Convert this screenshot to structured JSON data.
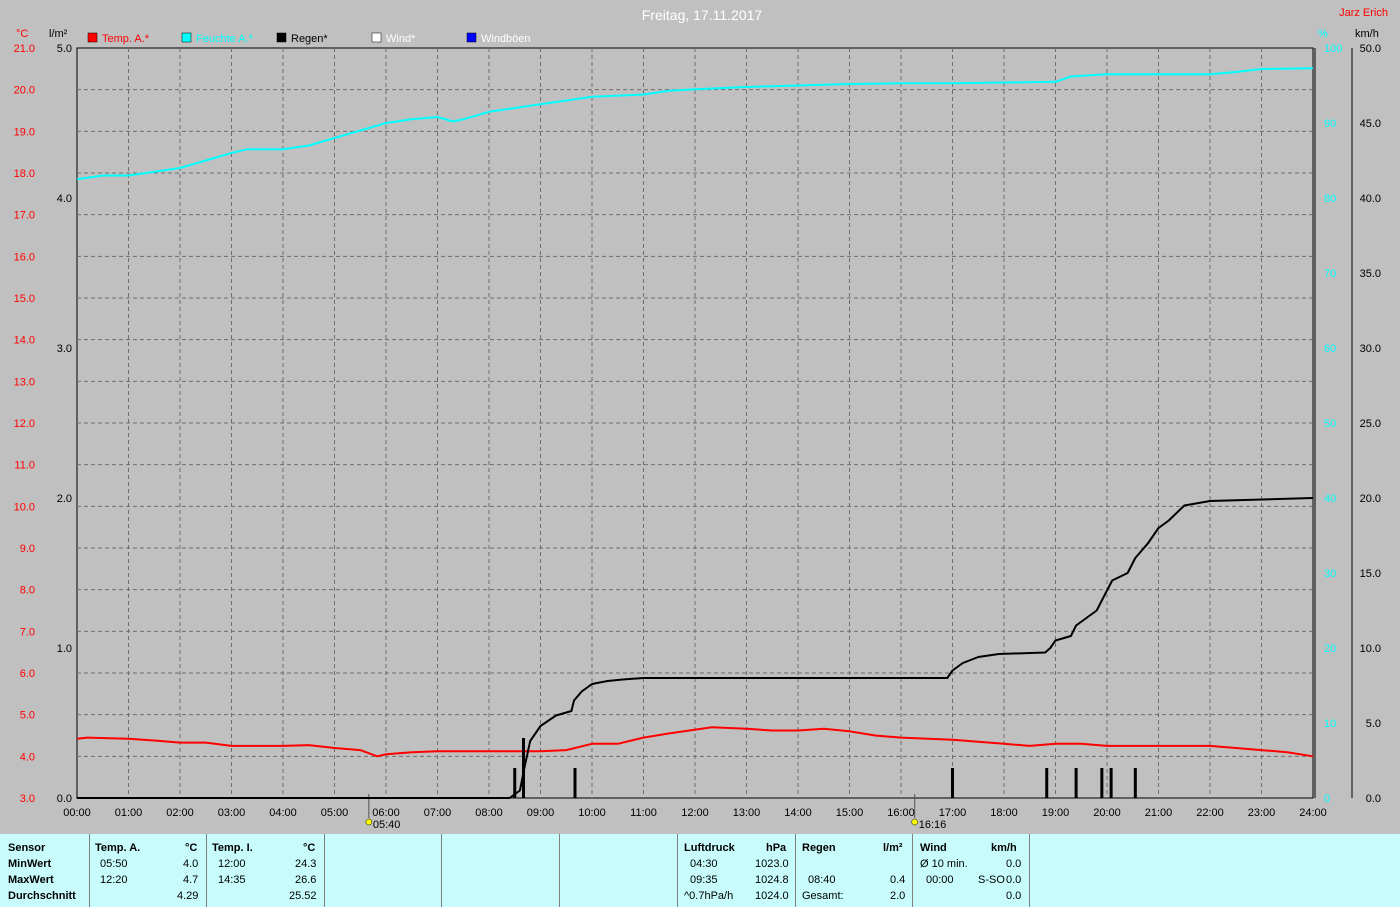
{
  "header": {
    "title": "Freitag, 17.11.2017",
    "station": "Jarz Erich",
    "unit_temp": "°C",
    "unit_rain": "l/m²",
    "unit_pressure": "%",
    "unit_wind": "km/h"
  },
  "colors": {
    "background": "#c0c0c0",
    "temp": "#ff0000",
    "pressure": "#00ffff",
    "rain": "#000000",
    "table_bg": "#c8fcfc"
  },
  "legend": [
    {
      "label": "Temp. A.*",
      "color": "#ff0000"
    },
    {
      "label": "Feuchte A.*",
      "color": "#00ffff"
    },
    {
      "label": "Regen*",
      "color": "#000000"
    },
    {
      "label": "Wind*",
      "color": "#ffffff"
    },
    {
      "label": "Windböen",
      "color": "#0000ff"
    }
  ],
  "axes": {
    "temp_ticks": [
      "21.0",
      "20.0",
      "19.0",
      "18.0",
      "17.0",
      "16.0",
      "15.0",
      "14.0",
      "13.0",
      "12.0",
      "11.0",
      "10.0",
      "9.0",
      "8.0",
      "7.0",
      "6.0",
      "5.0",
      "4.0",
      "3.0"
    ],
    "rain_ticks": [
      "5.0",
      "4.0",
      "3.0",
      "2.0",
      "1.0",
      "0.0"
    ],
    "humidity_ticks": [
      "100",
      "90",
      "80",
      "70",
      "60",
      "50",
      "40",
      "30",
      "20",
      "10",
      "0"
    ],
    "wind_ticks": [
      "50.0",
      "45.0",
      "40.0",
      "35.0",
      "30.0",
      "25.0",
      "20.0",
      "15.0",
      "10.0",
      "5.0",
      "0.0"
    ],
    "time_ticks": [
      "00:00",
      "01:00",
      "02:00",
      "03:00",
      "04:00",
      "05:00",
      "06:00",
      "07:00",
      "08:00",
      "09:00",
      "10:00",
      "11:00",
      "12:00",
      "13:00",
      "14:00",
      "15:00",
      "16:00",
      "17:00",
      "18:00",
      "19:00",
      "20:00",
      "21:00",
      "22:00",
      "23:00",
      "24:00"
    ],
    "sunrise": "05:40",
    "sunset": "16:16"
  },
  "chart_data": {
    "type": "line",
    "title": "Freitag, 17.11.2017",
    "x_unit": "hours",
    "temp_range": [
      3,
      21
    ],
    "rain_range": [
      0,
      5
    ],
    "humidity_range": [
      0,
      100
    ],
    "series": [
      {
        "name": "Temp. A.*",
        "axis": "temp",
        "points": [
          [
            0,
            4.42
          ],
          [
            0.2,
            4.45
          ],
          [
            1,
            4.42
          ],
          [
            1.5,
            4.38
          ],
          [
            2,
            4.33
          ],
          [
            2.5,
            4.33
          ],
          [
            3,
            4.25
          ],
          [
            4,
            4.25
          ],
          [
            4.5,
            4.27
          ],
          [
            5,
            4.2
          ],
          [
            5.5,
            4.15
          ],
          [
            5.83,
            4.0
          ],
          [
            6,
            4.05
          ],
          [
            6.5,
            4.1
          ],
          [
            7,
            4.12
          ],
          [
            8,
            4.12
          ],
          [
            9,
            4.12
          ],
          [
            9.5,
            4.15
          ],
          [
            10,
            4.3
          ],
          [
            10.5,
            4.3
          ],
          [
            11,
            4.45
          ],
          [
            11.5,
            4.55
          ],
          [
            12.33,
            4.7
          ],
          [
            13,
            4.66
          ],
          [
            13.5,
            4.62
          ],
          [
            14,
            4.62
          ],
          [
            14.5,
            4.66
          ],
          [
            15,
            4.6
          ],
          [
            15.5,
            4.5
          ],
          [
            16,
            4.45
          ],
          [
            17,
            4.4
          ],
          [
            17.5,
            4.35
          ],
          [
            18,
            4.3
          ],
          [
            18.5,
            4.25
          ],
          [
            19,
            4.3
          ],
          [
            19.5,
            4.3
          ],
          [
            20,
            4.25
          ],
          [
            21,
            4.25
          ],
          [
            22,
            4.25
          ],
          [
            22.5,
            4.2
          ],
          [
            23,
            4.15
          ],
          [
            23.5,
            4.1
          ],
          [
            24,
            4.0
          ]
        ]
      },
      {
        "name": "Feuchte A.*",
        "axis": "humidity",
        "points": [
          [
            0,
            82.5
          ],
          [
            0.5,
            83
          ],
          [
            1,
            83
          ],
          [
            1.5,
            83.5
          ],
          [
            2,
            84
          ],
          [
            2.5,
            85
          ],
          [
            3,
            86
          ],
          [
            3.3,
            86.5
          ],
          [
            3.5,
            86.5
          ],
          [
            4,
            86.5
          ],
          [
            4.5,
            87
          ],
          [
            5,
            88
          ],
          [
            5.5,
            89
          ],
          [
            6,
            90
          ],
          [
            6.5,
            90.5
          ],
          [
            7,
            90.8
          ],
          [
            7.3,
            90.2
          ],
          [
            7.5,
            90.5
          ],
          [
            8,
            91.5
          ],
          [
            8.5,
            92
          ],
          [
            9,
            92.5
          ],
          [
            9.5,
            93
          ],
          [
            10,
            93.5
          ],
          [
            11,
            93.8
          ],
          [
            11.5,
            94.3
          ],
          [
            12,
            94.5
          ],
          [
            13,
            94.8
          ],
          [
            14,
            95
          ],
          [
            15,
            95.2
          ],
          [
            16,
            95.3
          ],
          [
            17,
            95.3
          ],
          [
            18,
            95.4
          ],
          [
            19,
            95.5
          ],
          [
            19.3,
            96.2
          ],
          [
            20,
            96.5
          ],
          [
            21,
            96.5
          ],
          [
            22,
            96.5
          ],
          [
            22.5,
            96.8
          ],
          [
            23,
            97.2
          ],
          [
            24,
            97.3
          ]
        ]
      },
      {
        "name": "Regen*",
        "axis": "rain",
        "kind": "cumulative",
        "points": [
          [
            0,
            0
          ],
          [
            8.4,
            0
          ],
          [
            8.6,
            0.05
          ],
          [
            8.7,
            0.22
          ],
          [
            8.8,
            0.38
          ],
          [
            9,
            0.48
          ],
          [
            9.3,
            0.55
          ],
          [
            9.6,
            0.58
          ],
          [
            9.65,
            0.65
          ],
          [
            9.8,
            0.71
          ],
          [
            10,
            0.76
          ],
          [
            10.3,
            0.78
          ],
          [
            10.6,
            0.79
          ],
          [
            11,
            0.8
          ],
          [
            16.9,
            0.8
          ],
          [
            17,
            0.85
          ],
          [
            17.2,
            0.9
          ],
          [
            17.5,
            0.94
          ],
          [
            17.9,
            0.96
          ],
          [
            18.8,
            0.97
          ],
          [
            18.9,
            1.0
          ],
          [
            19,
            1.05
          ],
          [
            19.3,
            1.08
          ],
          [
            19.4,
            1.15
          ],
          [
            19.6,
            1.2
          ],
          [
            19.8,
            1.25
          ],
          [
            19.95,
            1.35
          ],
          [
            20.1,
            1.45
          ],
          [
            20.4,
            1.5
          ],
          [
            20.55,
            1.6
          ],
          [
            20.8,
            1.7
          ],
          [
            21,
            1.8
          ],
          [
            21.2,
            1.85
          ],
          [
            21.5,
            1.95
          ],
          [
            22,
            1.98
          ],
          [
            24,
            2.0
          ]
        ]
      },
      {
        "name": "Regen* bars",
        "axis": "rain",
        "kind": "bars",
        "points": [
          [
            8.5,
            0.2
          ],
          [
            8.67,
            0.4
          ],
          [
            9.67,
            0.2
          ],
          [
            17,
            0.2
          ],
          [
            18.83,
            0.2
          ],
          [
            19.4,
            0.2
          ],
          [
            19.9,
            0.2
          ],
          [
            20.08,
            0.2
          ],
          [
            20.55,
            0.2
          ]
        ]
      }
    ]
  },
  "table": {
    "rows": [
      "Sensor",
      "MinWert",
      "MaxWert",
      "Durchschnitt"
    ],
    "temp_a": {
      "title": "Temp. A.",
      "unit": "°C",
      "min_time": "05:50",
      "min_val": "4.0",
      "max_time": "12:20",
      "max_val": "4.7",
      "avg": "4.29"
    },
    "temp_i": {
      "title": "Temp. I.",
      "unit": "°C",
      "min_time": "12:00",
      "min_val": "24.3",
      "max_time": "14:35",
      "max_val": "26.6",
      "avg": "25.52"
    },
    "pressure": {
      "title": "Luftdruck",
      "unit": "hPa",
      "min_time": "04:30",
      "min_val": "1023.0",
      "max_time": "09:35",
      "max_val": "1024.8",
      "trend_label": "^0.7hPa/h",
      "trend_val": "1024.0"
    },
    "rain": {
      "title": "Regen",
      "unit": "l/m²",
      "max_time": "08:40",
      "max_val": "0.4",
      "total_label": "Gesamt:",
      "total_val": "2.0"
    },
    "wind": {
      "title": "Wind",
      "unit": "km/h",
      "avg_label": "Ø 10 min.",
      "avg_val": "0.0",
      "max_time": "00:00",
      "max_dir": "S-SO",
      "max_val": "0.0",
      "last_val": "0.0"
    }
  }
}
